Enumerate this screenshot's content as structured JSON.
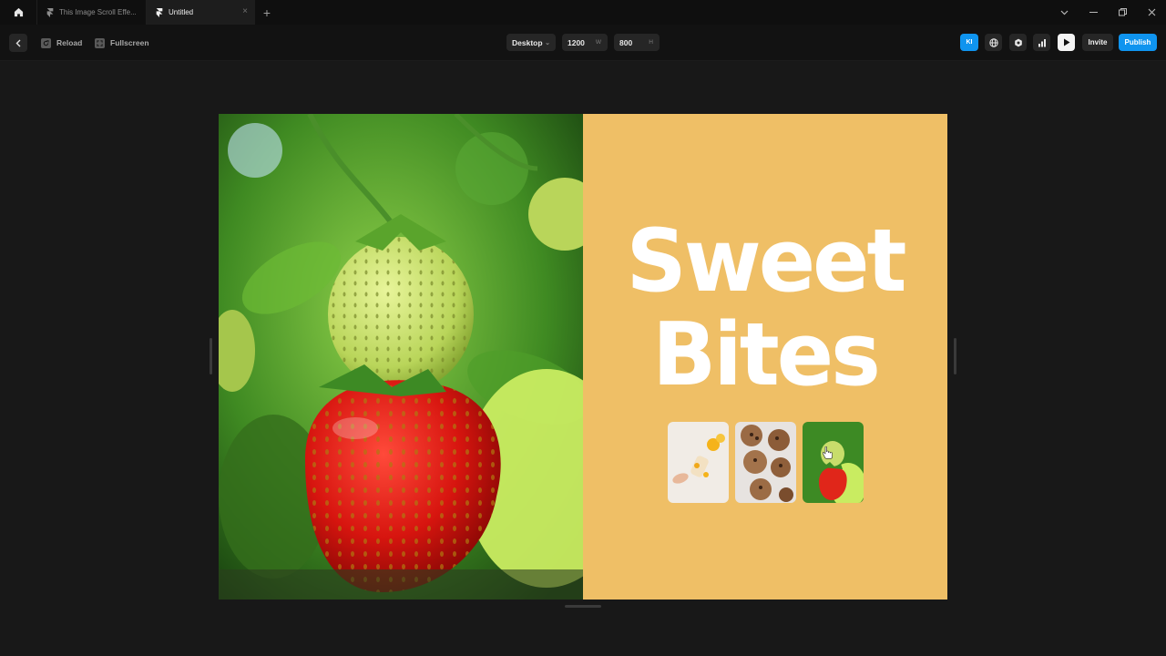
{
  "tabs": [
    {
      "label": "This Image Scroll Effe..."
    },
    {
      "label": "Untitled"
    }
  ],
  "toolbar": {
    "reload_label": "Reload",
    "fullscreen_label": "Fullscreen",
    "breakpoint": "Desktop",
    "width_value": "1200",
    "width_unit": "W",
    "height_value": "800",
    "height_unit": "H",
    "avatar_initials": "KI",
    "invite_label": "Invite",
    "publish_label": "Publish"
  },
  "preview": {
    "headline_line1": "Sweet",
    "headline_line2": "Bites",
    "background_color": "#efbf66",
    "thumbnails": [
      {
        "subject": "ice-pop-with-mango"
      },
      {
        "subject": "chocolate-chip-cookies"
      },
      {
        "subject": "strawberries"
      }
    ]
  },
  "colors": {
    "accent": "#0f94ef",
    "canvas": "#181818"
  }
}
